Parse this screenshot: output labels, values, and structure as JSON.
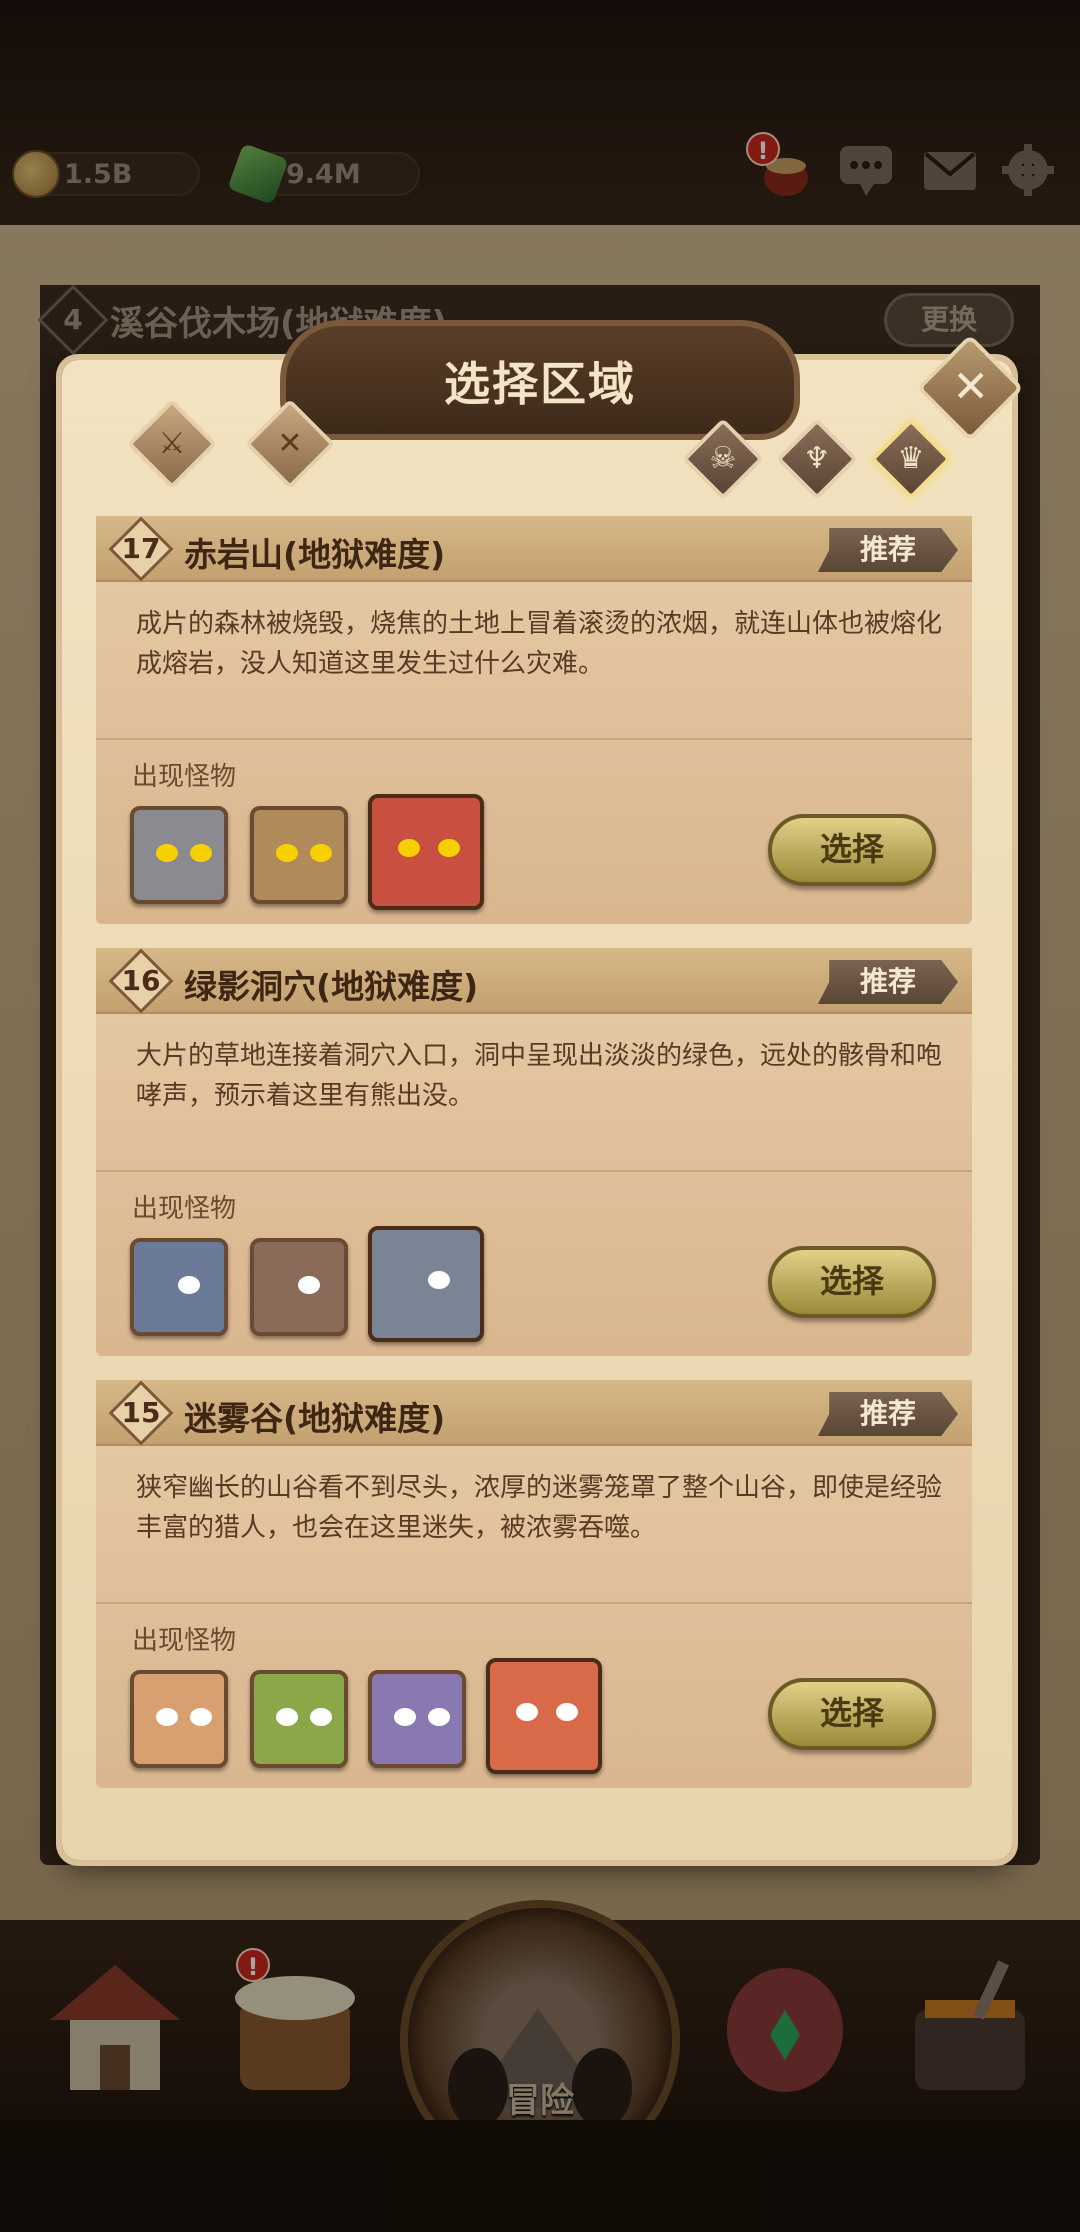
{
  "resources": {
    "gold": "1.5B",
    "gems": "9.4M"
  },
  "alerts": {
    "shop": "!",
    "tavern": "!"
  },
  "background_stage": {
    "number": "4",
    "title": "溪谷伐木场(地狱难度)",
    "change_label": "更换"
  },
  "modal": {
    "title": "选择区域",
    "close_label": "✕",
    "filters_left": [
      {
        "icon": "sword-icon"
      },
      {
        "icon": "crossed-swords-icon"
      }
    ],
    "filters_right": [
      {
        "icon": "skull-icon"
      },
      {
        "icon": "demon-icon"
      },
      {
        "icon": "boss-skull-icon",
        "active": true
      }
    ]
  },
  "areas": [
    {
      "level": "17",
      "name": "赤岩山(地狱难度)",
      "recommend": "推荐",
      "description": "成片的森林被烧毁，烧焦的土地上冒着滚烫的浓烟，就连山体也被熔化成熔岩，没人知道这里发生过什么灾难。",
      "monsters_label": "出现怪物",
      "monsters": [
        {
          "icon": "stone-golem-icon",
          "color": "#8a8a90",
          "boss": false
        },
        {
          "icon": "rock-golem-icon",
          "color": "#b08a5a",
          "boss": false
        },
        {
          "icon": "lava-golem-icon",
          "color": "#c85040",
          "boss": true
        }
      ],
      "select_label": "选择"
    },
    {
      "level": "16",
      "name": "绿影洞穴(地狱难度)",
      "recommend": "推荐",
      "description": "大片的草地连接着洞穴入口，洞中呈现出淡淡的绿色，远处的骸骨和咆哮声，预示着这里有熊出没。",
      "monsters_label": "出现怪物",
      "monsters": [
        {
          "icon": "blue-bear-icon",
          "color": "#6a7a98",
          "boss": false
        },
        {
          "icon": "brown-bear-icon",
          "color": "#8a6a58",
          "boss": false
        },
        {
          "icon": "scarred-bear-icon",
          "color": "#7a8494",
          "boss": true
        }
      ],
      "select_label": "选择"
    },
    {
      "level": "15",
      "name": "迷雾谷(地狱难度)",
      "recommend": "推荐",
      "description": "狭窄幽长的山谷看不到尽头，浓厚的迷雾笼罩了整个山谷，即使是经验丰富的猎人，也会在这里迷失，被浓雾吞噬。",
      "monsters_label": "出现怪物",
      "monsters": [
        {
          "icon": "red-troll-icon",
          "color": "#d8a070",
          "boss": false
        },
        {
          "icon": "green-troll-icon",
          "color": "#8aa848",
          "boss": false
        },
        {
          "icon": "purple-troll-icon",
          "color": "#8a78b0",
          "boss": false
        },
        {
          "icon": "ogre-chief-icon",
          "color": "#d86a4a",
          "boss": true
        }
      ],
      "select_label": "选择"
    }
  ],
  "bottom_nav": {
    "items": [
      {
        "icon": "house-icon"
      },
      {
        "icon": "tavern-mug-icon"
      },
      {
        "icon": "adventure-portal-icon",
        "label": "冒险"
      },
      {
        "icon": "armor-icon"
      },
      {
        "icon": "forge-icon"
      }
    ]
  }
}
